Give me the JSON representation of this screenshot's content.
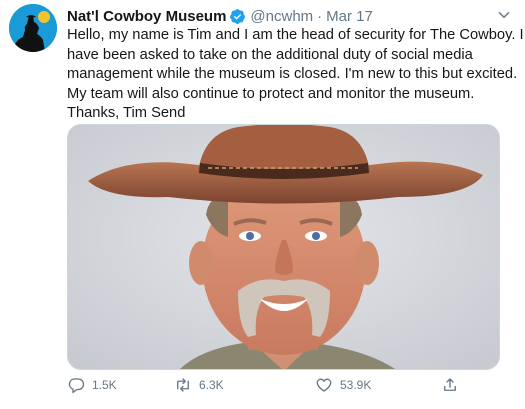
{
  "tweet": {
    "name": "Nat'l Cowboy Museum",
    "handle": "@ncwhm",
    "separator": "·",
    "date": "Mar 17",
    "text_lines": [
      "Hello, my name is Tim and I am the head of security for The Cowboy. I",
      "have been asked to take on the additional duty of social media",
      "management while the museum is closed. I'm new to this but excited.",
      "My team will also continue to protect and monitor the museum.",
      "Thanks, Tim Send"
    ],
    "replies": "1.5K",
    "retweets": "6.3K",
    "likes": "53.9K"
  },
  "colors": {
    "avatar_bg": "#1a9bd7",
    "verified": "#1da1f2",
    "muted": "#657786"
  },
  "icons": [
    "verified-badge-icon",
    "chevron-down-icon",
    "reply-icon",
    "retweet-icon",
    "like-icon",
    "share-icon"
  ]
}
